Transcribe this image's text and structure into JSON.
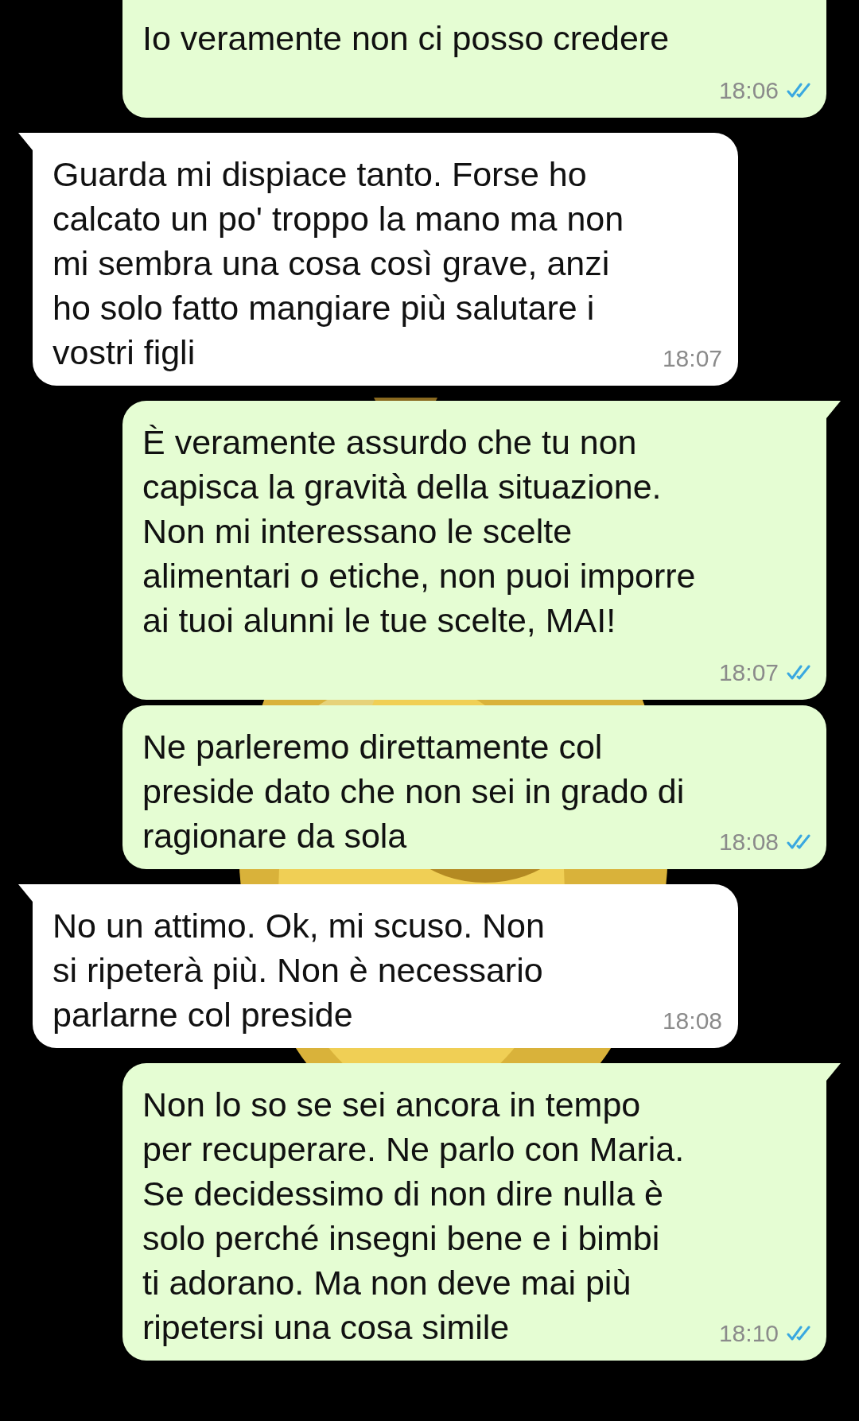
{
  "messages": [
    {
      "kind": "outgoing",
      "text": "Io veramente non ci posso credere",
      "time": "18:06",
      "read": true,
      "tail": false
    },
    {
      "kind": "incoming",
      "text": "Guarda mi dispiace tanto. Forse ho\ncalcato un po' troppo la mano ma non\nmi sembra una cosa così grave, anzi\nho solo fatto mangiare più salutare i\nvostri figli",
      "time": "18:07",
      "tail": true
    },
    {
      "kind": "outgoing",
      "text": "È veramente assurdo che tu non\ncapisca la gravità della situazione.\nNon mi interessano le scelte\nalimentari o etiche, non puoi imporre\nai tuoi alunni le tue scelte, MAI!",
      "time": "18:07",
      "read": true,
      "tail": true
    },
    {
      "kind": "outgoing",
      "text": "Ne parleremo direttamente col\npreside dato che non sei in grado di\nragionare da sola",
      "time": "18:08",
      "read": true,
      "tail": false
    },
    {
      "kind": "incoming",
      "text": "No un attimo. Ok, mi scuso. Non\nsi ripeterà più. Non è necessario\nparlarne col preside",
      "time": "18:08",
      "tail": true
    },
    {
      "kind": "outgoing",
      "text": "Non lo so se sei ancora in tempo\nper recuperare. Ne parlo con Maria.\nSe decidessimo di non dire nulla è\nsolo perché insegni bene e i bimbi\nti adorano. Ma non deve mai più\nripetersi una cosa simile",
      "time": "18:10",
      "read": true,
      "tail": true
    }
  ]
}
